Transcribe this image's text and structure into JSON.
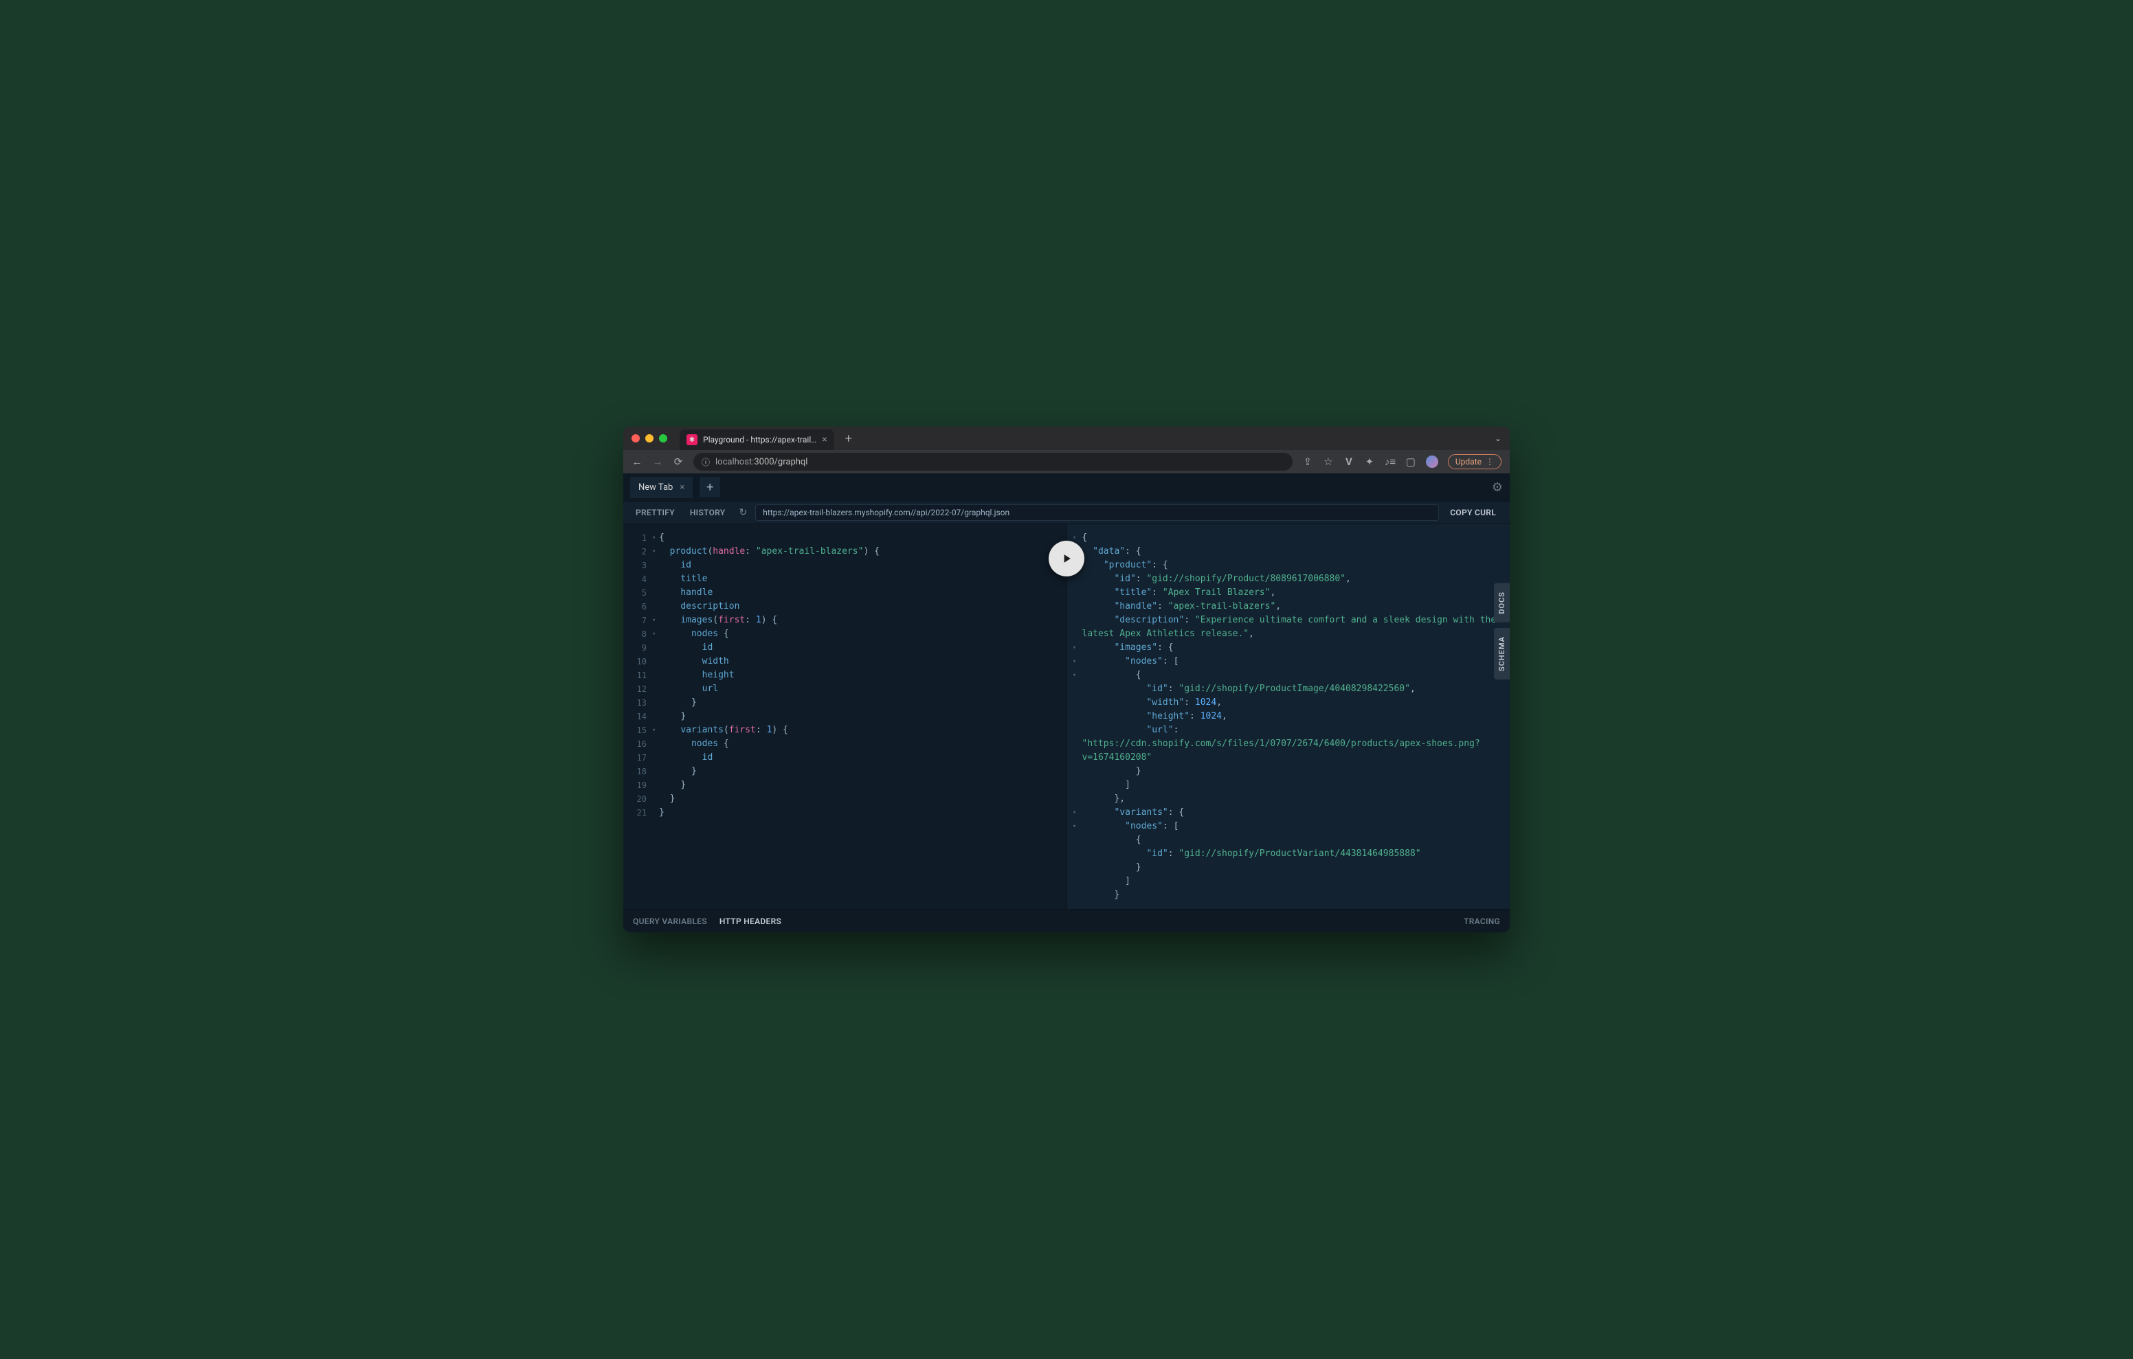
{
  "browser": {
    "tab_title": "Playground - https://apex-trail…",
    "url_host": "localhost:",
    "url_port_path": "3000/graphql",
    "update_label": "Update"
  },
  "playground": {
    "tab_label": "New Tab",
    "toolbar": {
      "prettify": "PRETTIFY",
      "history": "HISTORY",
      "endpoint": "https://apex-trail-blazers.myshopify.com//api/2022-07/graphql.json",
      "copy_curl": "COPY CURL"
    },
    "sidetabs": {
      "docs": "DOCS",
      "schema": "SCHEMA"
    },
    "footer": {
      "vars": "QUERY VARIABLES",
      "headers": "HTTP HEADERS",
      "tracing": "TRACING"
    }
  },
  "query": {
    "lines": [
      {
        "n": "1",
        "fold": "▾",
        "html": "<span class='punct'>{</span>"
      },
      {
        "n": "2",
        "fold": "▾",
        "html": "  <span class='fn'>product</span><span class='punct'>(</span><span class='arg'>handle</span><span class='punct'>: </span><span class='str'>\"apex-trail-blazers\"</span><span class='punct'>) {</span>"
      },
      {
        "n": "3",
        "fold": "",
        "html": "    <span class='fn'>id</span>"
      },
      {
        "n": "4",
        "fold": "",
        "html": "    <span class='fn'>title</span>"
      },
      {
        "n": "5",
        "fold": "",
        "html": "    <span class='fn'>handle</span>"
      },
      {
        "n": "6",
        "fold": "",
        "html": "    <span class='fn'>description</span>"
      },
      {
        "n": "7",
        "fold": "▾",
        "html": "    <span class='fn'>images</span><span class='punct'>(</span><span class='arg'>first</span><span class='punct'>: </span><span class='num'>1</span><span class='punct'>) {</span>"
      },
      {
        "n": "8",
        "fold": "▾",
        "html": "      <span class='fn'>nodes</span><span class='punct'> {</span>"
      },
      {
        "n": "9",
        "fold": "",
        "html": "        <span class='fn'>id</span>"
      },
      {
        "n": "10",
        "fold": "",
        "html": "        <span class='fn'>width</span>"
      },
      {
        "n": "11",
        "fold": "",
        "html": "        <span class='fn'>height</span>"
      },
      {
        "n": "12",
        "fold": "",
        "html": "        <span class='fn'>url</span>"
      },
      {
        "n": "13",
        "fold": "",
        "html": "      <span class='punct'>}</span>"
      },
      {
        "n": "14",
        "fold": "",
        "html": "    <span class='punct'>}</span>"
      },
      {
        "n": "15",
        "fold": "▾",
        "html": "    <span class='fn'>variants</span><span class='punct'>(</span><span class='arg'>first</span><span class='punct'>: </span><span class='num'>1</span><span class='punct'>) {</span>"
      },
      {
        "n": "16",
        "fold": "",
        "html": "      <span class='fn'>nodes</span><span class='punct'> {</span>"
      },
      {
        "n": "17",
        "fold": "",
        "html": "        <span class='fn'>id</span>"
      },
      {
        "n": "18",
        "fold": "",
        "html": "      <span class='punct'>}</span>"
      },
      {
        "n": "19",
        "fold": "",
        "html": "    <span class='punct'>}</span>"
      },
      {
        "n": "20",
        "fold": "",
        "html": "  <span class='punct'>}</span>"
      },
      {
        "n": "21",
        "fold": "",
        "html": "<span class='punct'>}</span>"
      }
    ]
  },
  "response": {
    "lines": [
      {
        "fold": "▾",
        "html": "<span class='punct'>{</span>"
      },
      {
        "fold": "▾",
        "html": "  <span class='key'>\"data\"</span><span class='punct'>: {</span>"
      },
      {
        "fold": "▾",
        "html": "    <span class='key'>\"product\"</span><span class='punct'>: {</span>"
      },
      {
        "fold": "",
        "html": "      <span class='key'>\"id\"</span><span class='punct'>: </span><span class='str'>\"gid://shopify/Product/8089617006880\"</span><span class='punct'>,</span>"
      },
      {
        "fold": "",
        "html": "      <span class='key'>\"title\"</span><span class='punct'>: </span><span class='str'>\"Apex Trail Blazers\"</span><span class='punct'>,</span>"
      },
      {
        "fold": "",
        "html": "      <span class='key'>\"handle\"</span><span class='punct'>: </span><span class='str'>\"apex-trail-blazers\"</span><span class='punct'>,</span>"
      },
      {
        "fold": "",
        "html": "      <span class='key'>\"description\"</span><span class='punct'>: </span><span class='str'>\"Experience ultimate comfort and a sleek design with the latest Apex Athletics release.\"</span><span class='punct'>,</span>"
      },
      {
        "fold": "▾",
        "html": "      <span class='key'>\"images\"</span><span class='punct'>: {</span>"
      },
      {
        "fold": "▾",
        "html": "        <span class='key'>\"nodes\"</span><span class='punct'>: [</span>"
      },
      {
        "fold": "▾",
        "html": "          <span class='punct'>{</span>"
      },
      {
        "fold": "",
        "html": "            <span class='key'>\"id\"</span><span class='punct'>: </span><span class='str'>\"gid://shopify/ProductImage/40408298422560\"</span><span class='punct'>,</span>"
      },
      {
        "fold": "",
        "html": "            <span class='key'>\"width\"</span><span class='punct'>: </span><span class='num'>1024</span><span class='punct'>,</span>"
      },
      {
        "fold": "",
        "html": "            <span class='key'>\"height\"</span><span class='punct'>: </span><span class='num'>1024</span><span class='punct'>,</span>"
      },
      {
        "fold": "",
        "html": "            <span class='key'>\"url\"</span><span class='punct'>:</span>\n<span class='str'>\"https://cdn.shopify.com/s/files/1/0707/2674/6400/products/apex-shoes.png?v=1674160208\"</span>"
      },
      {
        "fold": "",
        "html": "          <span class='punct'>}</span>"
      },
      {
        "fold": "",
        "html": "        <span class='punct'>]</span>"
      },
      {
        "fold": "",
        "html": "      <span class='punct'>},</span>"
      },
      {
        "fold": "▾",
        "html": "      <span class='key'>\"variants\"</span><span class='punct'>: {</span>"
      },
      {
        "fold": "▾",
        "html": "        <span class='key'>\"nodes\"</span><span class='punct'>: [</span>"
      },
      {
        "fold": "",
        "html": "          <span class='punct'>{</span>"
      },
      {
        "fold": "",
        "html": "            <span class='key'>\"id\"</span><span class='punct'>: </span><span class='str'>\"gid://shopify/ProductVariant/44381464985888\"</span>"
      },
      {
        "fold": "",
        "html": "          <span class='punct'>}</span>"
      },
      {
        "fold": "",
        "html": "        <span class='punct'>]</span>"
      },
      {
        "fold": "",
        "html": "      <span class='punct'>}</span>"
      }
    ]
  }
}
